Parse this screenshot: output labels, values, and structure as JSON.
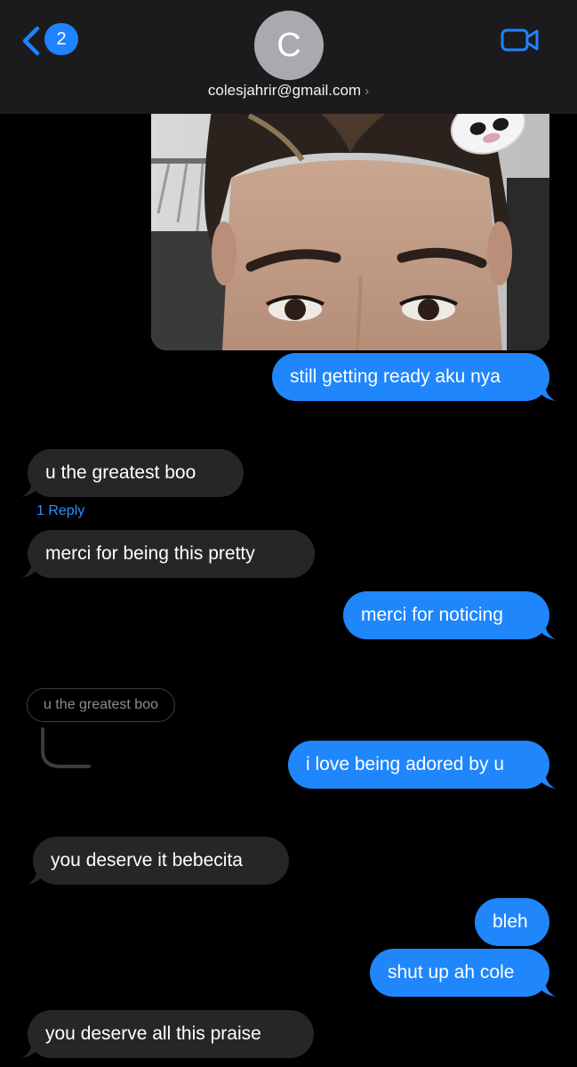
{
  "header": {
    "back_badge": "2",
    "avatar_initial": "C",
    "contact": "colesjahrir@gmail.com",
    "contact_chevron": "›",
    "icons": {
      "back": "chevron-left-icon",
      "video": "video-camera-icon",
      "contact_chevron": "chevron-right-icon"
    }
  },
  "colors": {
    "outgoing_bubble": "#1f86fb",
    "incoming_bubble": "#262628",
    "accent": "#1f82ff",
    "header_bg": "#1b1b1d"
  },
  "messages": [
    {
      "side": "out",
      "text": "still getting ready aku nya"
    },
    {
      "side": "in",
      "text": "u the greatest boo"
    },
    {
      "side": "in",
      "text": "merci for being this pretty"
    },
    {
      "side": "out",
      "text": "merci for noticing"
    },
    {
      "side": "out",
      "text": "i love being adored by u"
    },
    {
      "side": "in",
      "text": "you deserve it bebecita"
    },
    {
      "side": "out",
      "text": "bleh"
    },
    {
      "side": "out",
      "text": "shut up ah cole"
    },
    {
      "side": "in",
      "text": "you deserve all this praise"
    }
  ],
  "thread": {
    "reply_count": "1 Reply",
    "quoted_text": "u the greatest boo"
  }
}
